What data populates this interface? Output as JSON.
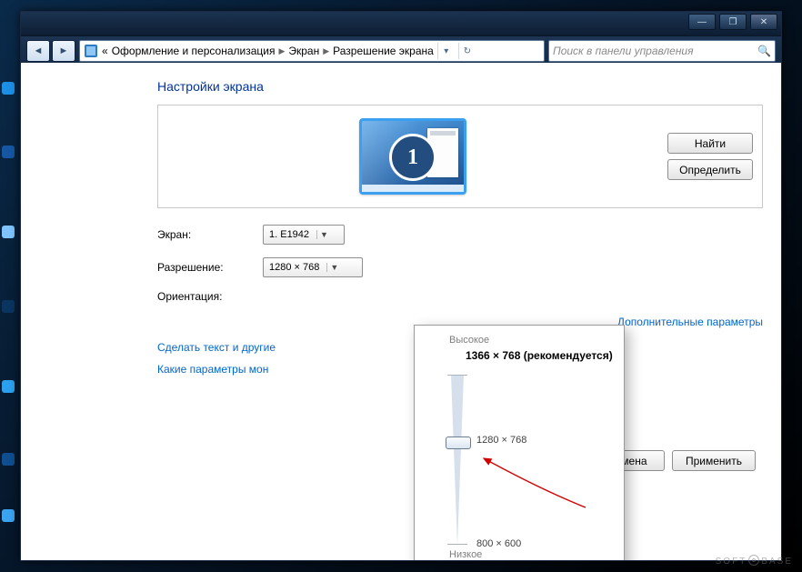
{
  "window": {
    "minimize_icon": "—",
    "maximize_icon": "❐",
    "close_icon": "✕"
  },
  "nav": {
    "back_icon": "◄",
    "forward_icon": "►"
  },
  "breadcrumb": {
    "root_prefix": "«",
    "items": [
      "Оформление и персонализация",
      "Экран",
      "Разрешение экрана"
    ],
    "dropdown_icon": "▾",
    "refresh_icon": "↻"
  },
  "search": {
    "placeholder": "Поиск в панели управления",
    "icon": "🔍"
  },
  "page": {
    "title": "Настройки экрана",
    "find_btn": "Найти",
    "detect_btn": "Определить"
  },
  "monitor": {
    "number": "1"
  },
  "form": {
    "screen_label": "Экран:",
    "screen_value": "1. E1942",
    "resolution_label": "Разрешение:",
    "resolution_value": "1280 × 768",
    "orientation_label": "Ориентация:"
  },
  "links": {
    "advanced": "Дополнительные параметры",
    "text_size": "Сделать текст и другие",
    "which_params": "Какие параметры мон"
  },
  "popup": {
    "high": "Высокое",
    "low": "Низкое",
    "recommended": "1366 × 768 (рекомендуется)",
    "current": "1280 × 768",
    "min": "800 × 600"
  },
  "actions": {
    "cancel": "Отмена",
    "apply": "Применить"
  },
  "watermark": {
    "left": "SOFT",
    "right": "BASE"
  }
}
